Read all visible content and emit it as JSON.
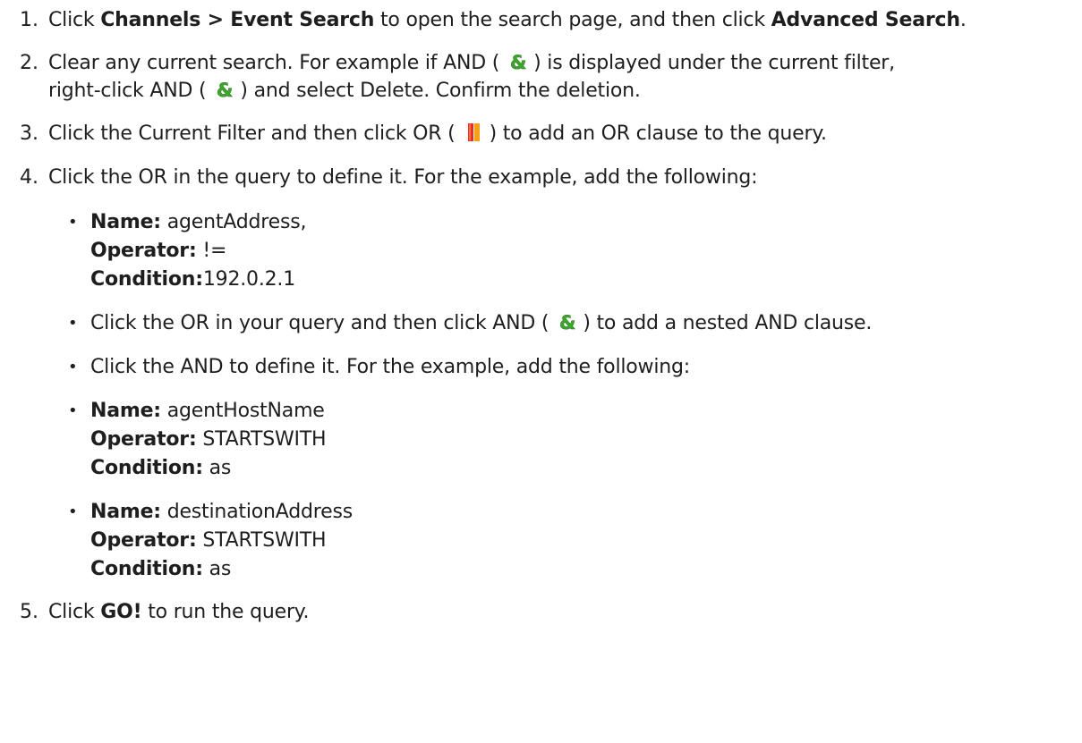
{
  "steps": [
    {
      "num": "1.",
      "parts": [
        "Click ",
        "Channels > Event Search",
        " to open the search page, and then click ",
        "Advanced Search",
        "."
      ]
    },
    {
      "num": "2.",
      "line1": [
        "Clear any current search. For example if AND (",
        ") is displayed under the current filter,"
      ],
      "line2": [
        "right-click AND (",
        ") and select Delete. Confirm the deletion."
      ]
    },
    {
      "num": "3.",
      "parts": [
        "Click the Current Filter and then click OR (",
        ") to add an OR clause to the query."
      ]
    },
    {
      "num": "4.",
      "text": "Click the OR in the query to define it. For the example, add the following:",
      "bullets": [
        {
          "name_label": "Name:",
          "name_value": " agentAddress,",
          "operator_label": "Operator:",
          "operator_value": " !=",
          "condition_label": "Condition:",
          "condition_value": "192.0.2.1"
        },
        {
          "parts": [
            "Click the OR in your query and then click AND (",
            ") to add a nested AND clause."
          ]
        },
        {
          "text": "Click the AND to define it. For the example, add the following:"
        },
        {
          "name_label": "Name:",
          "name_value": " agentHostName",
          "operator_label": "Operator:",
          "operator_value": " STARTSWITH",
          "condition_label": "Condition:",
          "condition_value": " as"
        },
        {
          "name_label": "Name:",
          "name_value": " destinationAddress",
          "operator_label": "Operator:",
          "operator_value": " STARTSWITH",
          "condition_label": "Condition:",
          "condition_value": " as"
        }
      ]
    },
    {
      "num": "5.",
      "parts": [
        "Click ",
        "GO!",
        " to run the query."
      ]
    }
  ],
  "icons": {
    "and": "and-ampersand-icon",
    "or": "or-bars-icon"
  },
  "colors": {
    "text": "#1e1e1e",
    "and_icon_green": "#3ea52e",
    "or_icon_red": "#e8321c",
    "or_icon_orange": "#f7a11a"
  }
}
